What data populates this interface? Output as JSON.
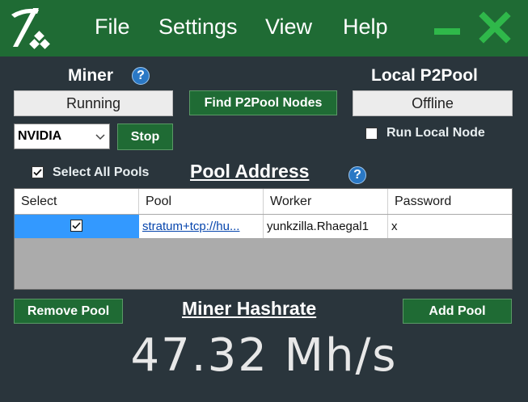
{
  "menu": {
    "file": "File",
    "settings": "Settings",
    "view": "View",
    "help": "Help"
  },
  "icons": {
    "logo": "pickaxe-icon",
    "minimize": "minimize-icon",
    "close": "close-icon",
    "help": "question-icon"
  },
  "colors": {
    "accent_green": "#1f6b34",
    "background": "#2a353c",
    "selection_blue": "#3399ff",
    "help_blue": "#2a78c5"
  },
  "miner": {
    "title": "Miner",
    "status": "Running",
    "device": "NVIDIA",
    "stop_label": "Stop"
  },
  "p2pool": {
    "find_nodes_label": "Find P2Pool Nodes",
    "title": "Local P2Pool",
    "status": "Offline",
    "run_local_label": "Run Local Node",
    "run_local_checked": false
  },
  "pools": {
    "select_all_label": "Select All Pools",
    "select_all_checked": true,
    "heading": "Pool Address",
    "columns": [
      "Select",
      "Pool",
      "Worker",
      "Password"
    ],
    "rows": [
      {
        "selected": true,
        "pool": "stratum+tcp://hu...",
        "worker": "yunkzilla.Rhaegal1",
        "password": "x"
      }
    ],
    "remove_label": "Remove Pool",
    "add_label": "Add Pool"
  },
  "hashrate": {
    "title": "Miner Hashrate",
    "value": "47.32 Mh/s"
  }
}
